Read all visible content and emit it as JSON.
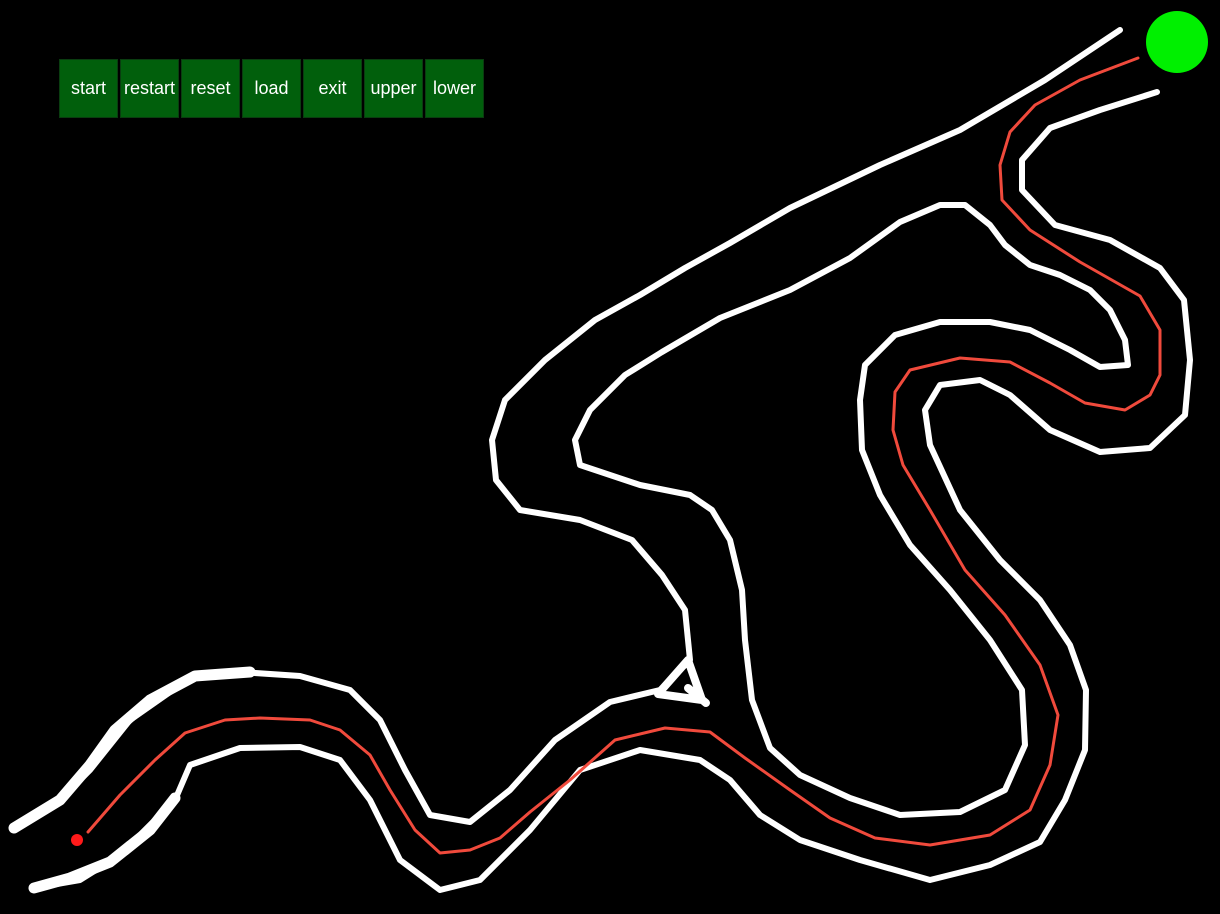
{
  "toolbar": {
    "buttons": [
      {
        "id": "start",
        "label": "start"
      },
      {
        "id": "restart",
        "label": "restart"
      },
      {
        "id": "reset",
        "label": "reset"
      },
      {
        "id": "load",
        "label": "load"
      },
      {
        "id": "exit",
        "label": "exit"
      },
      {
        "id": "upper",
        "label": "upper"
      },
      {
        "id": "lower",
        "label": "lower"
      }
    ]
  },
  "colors": {
    "background": "#000000",
    "wall": "#ffffff",
    "path": "#f04a3c",
    "start_marker": "#ff1a1a",
    "goal_marker": "#00f000",
    "button_bg": "#015f0c",
    "button_text": "#ffffff"
  },
  "markers": {
    "start": "start-dot",
    "goal": "goal-circle"
  }
}
